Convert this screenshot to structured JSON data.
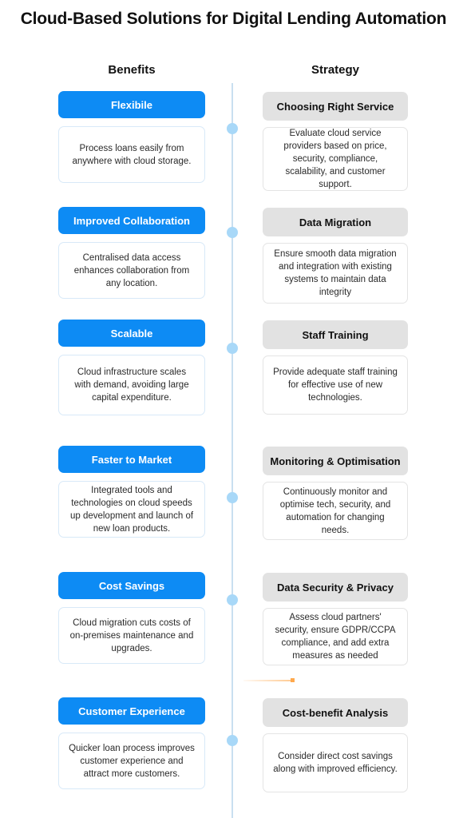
{
  "title": "Cloud-Based Solutions for Digital Lending Automation",
  "columns": {
    "left_header": "Benefits",
    "right_header": "Strategy"
  },
  "colors": {
    "benefit_pill": "#0d8bf4",
    "strategy_pill": "#e2e2e2",
    "timeline_line": "#c9dff0",
    "timeline_dot": "#a8d8f8",
    "benefit_card_border": "#d8e9f8",
    "strategy_card_border": "#e4e4e4",
    "title_text": "#111111",
    "accent_connector": "#ffa94d"
  },
  "rows": [
    {
      "benefit": {
        "label": "Flexibile",
        "description": "Process loans easily from anywhere with cloud storage."
      },
      "strategy": {
        "label": "Choosing Right Service",
        "description": "Evaluate cloud service providers based on price, security, compliance, scalability, and customer support."
      }
    },
    {
      "benefit": {
        "label": "Improved Collaboration",
        "description": "Centralised data access enhances collaboration from any location."
      },
      "strategy": {
        "label": "Data Migration",
        "description": "Ensure smooth data migration and integration with existing systems to maintain data integrity"
      }
    },
    {
      "benefit": {
        "label": "Scalable",
        "description": "Cloud infrastructure scales with demand, avoiding large capital expenditure."
      },
      "strategy": {
        "label": "Staff Training",
        "description": "Provide adequate staff training for effective use of new technologies."
      }
    },
    {
      "benefit": {
        "label": "Faster to Market",
        "description": "Integrated tools and technologies on cloud speeds up development and launch of new loan products."
      },
      "strategy": {
        "label": "Monitoring & Optimisation",
        "description": "Continuously monitor and optimise tech, security, and automation for changing needs."
      }
    },
    {
      "benefit": {
        "label": "Cost Savings",
        "description": "Cloud migration cuts costs of on-premises maintenance and upgrades."
      },
      "strategy": {
        "label": "Data Security & Privacy",
        "description": "Assess cloud partners' security, ensure GDPR/CCPA compliance, and add extra measures as needed"
      }
    },
    {
      "benefit": {
        "label": "Customer Experience",
        "description": "Quicker loan process improves customer experience and attract more customers."
      },
      "strategy": {
        "label": "Cost-benefit Analysis",
        "description": "Consider direct cost savings along with improved efficiency."
      }
    }
  ]
}
